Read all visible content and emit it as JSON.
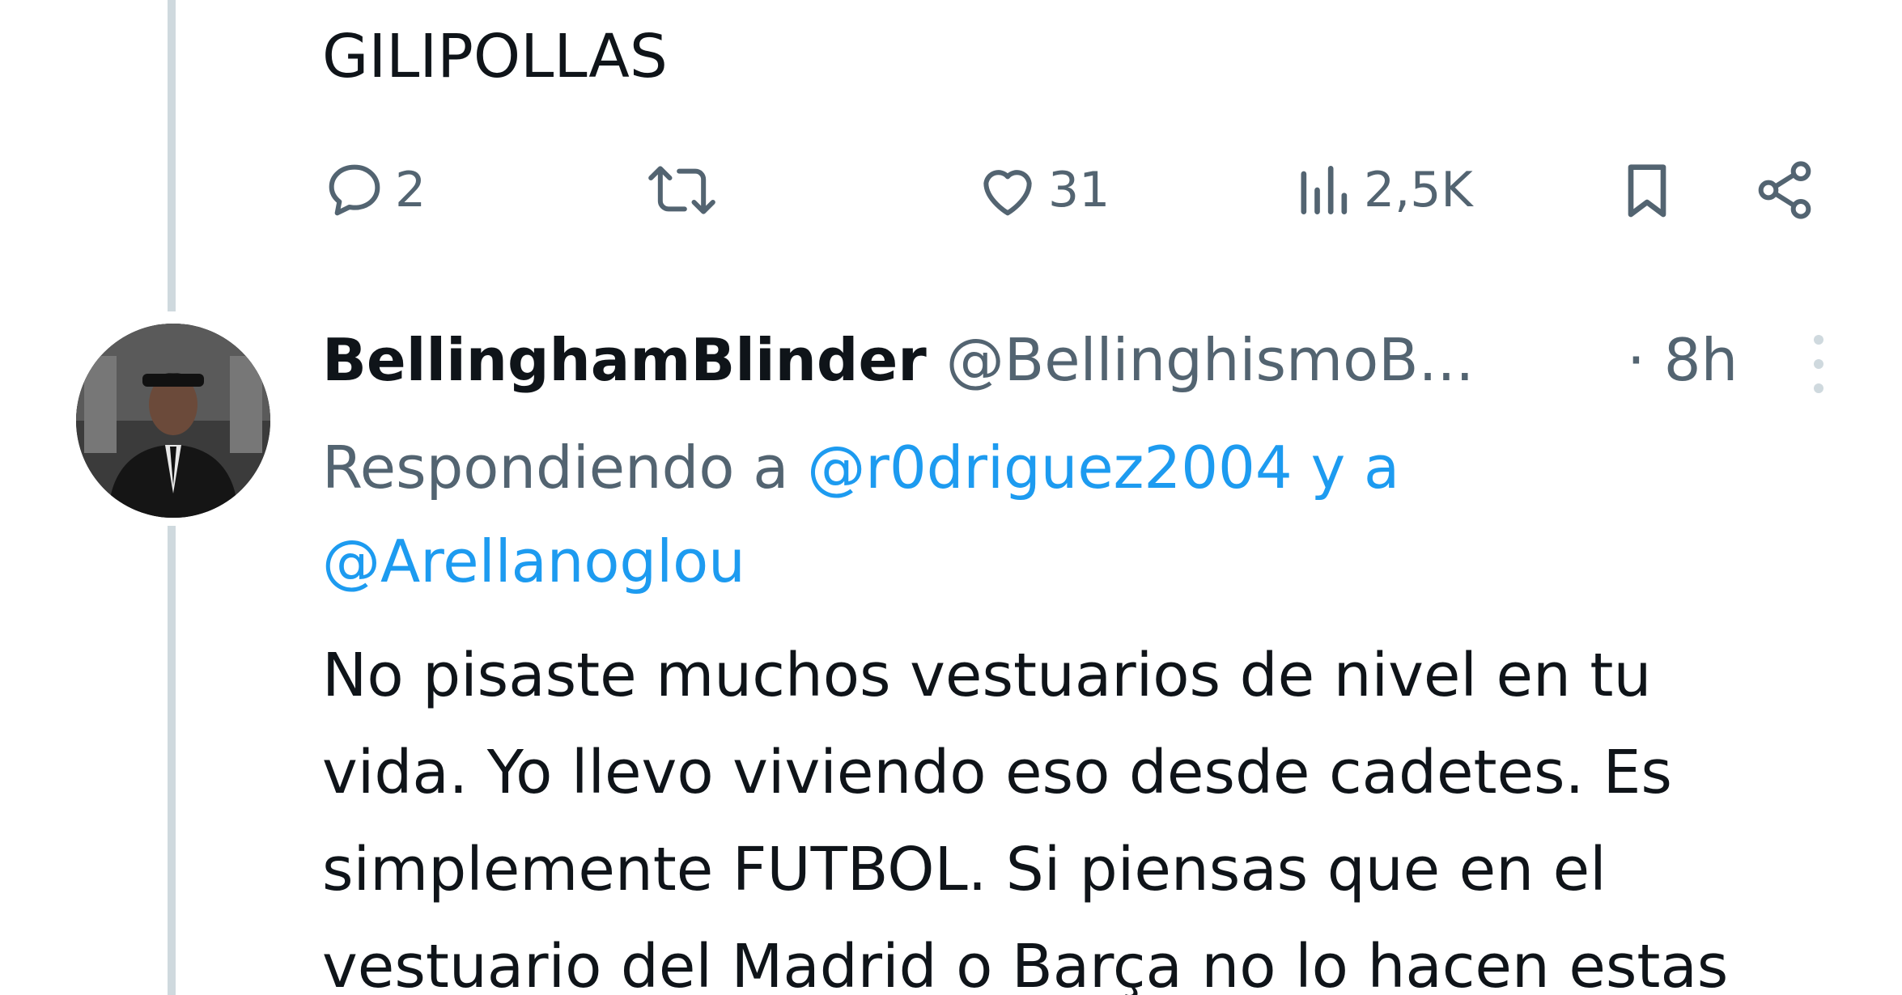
{
  "previous_tweet": {
    "text_top_cut": "...",
    "text": "GILIPOLLAS",
    "actions": {
      "replies": "2",
      "retweets": "",
      "likes": "31",
      "views": "2,5K"
    }
  },
  "reply_tweet": {
    "display_name": "BellinghamBlinder",
    "handle": "@BellinghismoB...",
    "time": "· 8h",
    "replying_prefix": "Respondiendo a",
    "replying_mention_1": "@r0driguez2004",
    "replying_conjunction": "y a",
    "replying_mention_2": "@Arellanoglou",
    "body_lines": [
      "No pisaste muchos vestuarios de nivel en tu",
      "vida. Yo llevo viviendo eso desde cadetes. Es",
      "simplemente FUTBOL. Si piensas que en el",
      "vestuario del Madrid o Barça no lo hacen estas"
    ]
  },
  "colors": {
    "text": "#0f1419",
    "secondary": "#536471",
    "link": "#1d9bf0",
    "thread_line": "#cfd9de"
  },
  "icons": {
    "reply": "speech-bubble-icon",
    "retweet": "retweet-arrows-icon",
    "like": "heart-icon",
    "views": "bar-chart-icon",
    "bookmark": "bookmark-icon",
    "share": "share-icon",
    "more": "vertical-ellipsis-icon"
  }
}
